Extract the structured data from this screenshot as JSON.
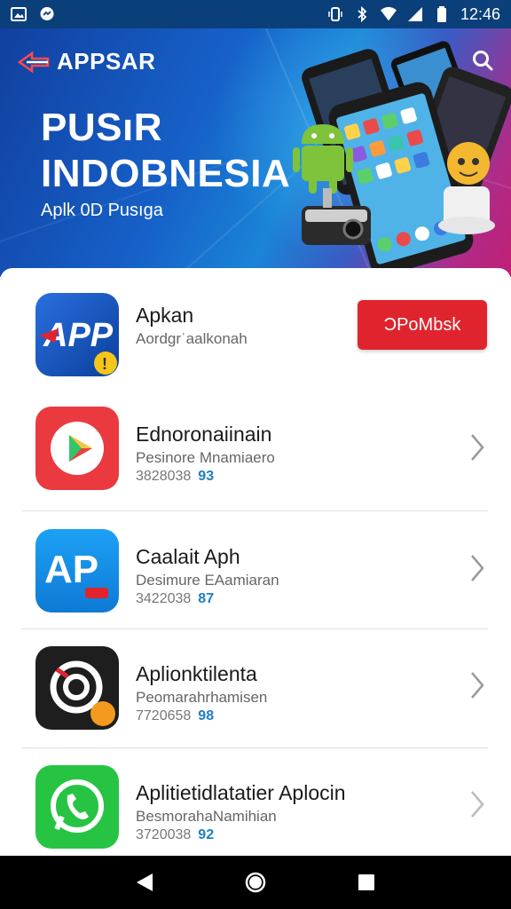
{
  "status_bar": {
    "time": "12:46",
    "left_icons": [
      "image-icon",
      "messenger-icon"
    ],
    "right_icons": [
      "vibrate-icon",
      "bluetooth-icon",
      "wifi-icon",
      "signal-icon",
      "battery-icon"
    ]
  },
  "hero": {
    "brand": "APPSAR",
    "title_line1": "PUSıR",
    "title_line2": "INDOBNESIA",
    "subtitle": "Aplk 0D Pusıga"
  },
  "featured": {
    "name": "Apkan",
    "subtitle": "Aordgrˈaalkonah",
    "button_label": "ƆPoMbsk",
    "icon": "app-logo-icon"
  },
  "apps": [
    {
      "name": "Ednoronaiinain",
      "developer": "Pesinore Mnamiaero",
      "downloads": "3828038",
      "rating": "93",
      "icon": "play-store-icon"
    },
    {
      "name": "Caalait Aph",
      "developer": "Desimure EAamiaran",
      "downloads": "3422038",
      "rating": "87",
      "icon": "ap-icon"
    },
    {
      "name": "Aplionktilenta",
      "developer": "Peomarahrhamisen",
      "downloads": "7720658",
      "rating": "98",
      "icon": "camera-lens-icon"
    },
    {
      "name": "Aplitietidlatatier Aplocin",
      "developer": "BesmorahaNamihian",
      "downloads": "3720038",
      "rating": "92",
      "icon": "phone-icon"
    }
  ],
  "nav": {
    "buttons": [
      "back-icon",
      "home-icon",
      "recents-icon"
    ]
  },
  "colors": {
    "accent": "#e0242e",
    "rating": "#1e7fc2",
    "hero_start": "#1140a0",
    "hero_end": "#c01f74"
  }
}
